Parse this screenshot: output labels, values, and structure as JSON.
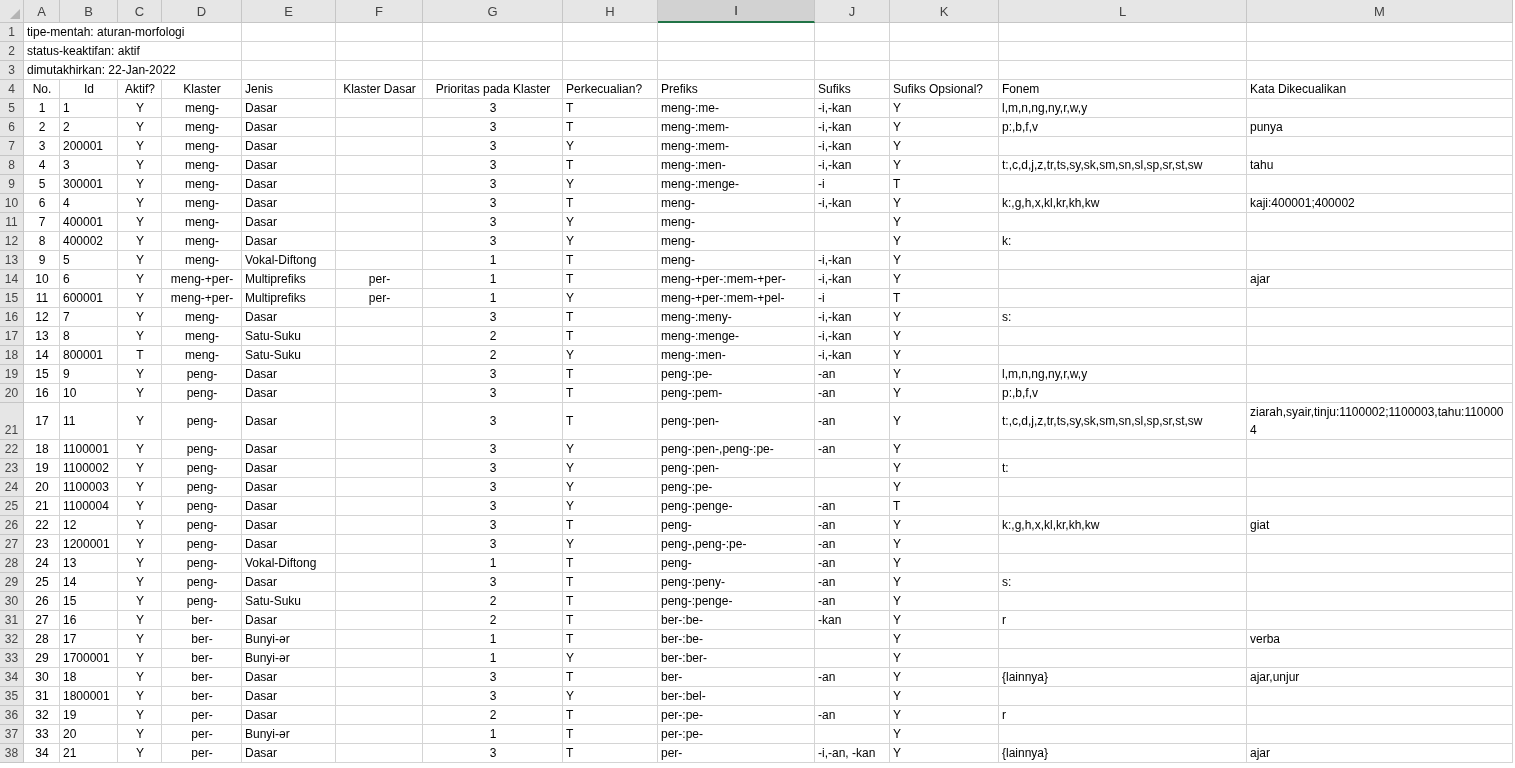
{
  "columns": [
    {
      "letter": "A",
      "selected": false
    },
    {
      "letter": "B",
      "selected": false
    },
    {
      "letter": "C",
      "selected": false
    },
    {
      "letter": "D",
      "selected": false
    },
    {
      "letter": "E",
      "selected": false
    },
    {
      "letter": "F",
      "selected": false
    },
    {
      "letter": "G",
      "selected": false
    },
    {
      "letter": "H",
      "selected": false
    },
    {
      "letter": "I",
      "selected": true
    },
    {
      "letter": "J",
      "selected": false
    },
    {
      "letter": "K",
      "selected": false
    },
    {
      "letter": "L",
      "selected": false
    },
    {
      "letter": "M",
      "selected": false
    }
  ],
  "rows": [
    {
      "n": "1",
      "title": "tipe-mentah: aturan-morfologi"
    },
    {
      "n": "2",
      "title": "status-keaktifan: aktif"
    },
    {
      "n": "3",
      "title": "dimutakhirkan: 22-Jan-2022"
    },
    {
      "n": "4",
      "header": true,
      "cells": [
        "No.",
        "Id",
        "Aktif?",
        "Klaster",
        "Jenis",
        "Klaster Dasar",
        "Prioritas pada Klaster",
        "Perkecualian?",
        "Prefiks",
        "Sufiks",
        "Sufiks Opsional?",
        "Fonem",
        "Kata Dikecualikan"
      ]
    },
    {
      "n": "5",
      "cells": [
        "1",
        "1",
        "Y",
        "meng-",
        "Dasar",
        null,
        "3",
        "T",
        "meng-:me-",
        "-i,-kan",
        "Y",
        "l,m,n,ng,ny,r,w,y",
        null
      ]
    },
    {
      "n": "6",
      "cells": [
        "2",
        "2",
        "Y",
        "meng-",
        "Dasar",
        null,
        "3",
        "T",
        "meng-:mem-",
        "-i,-kan",
        "Y",
        "p:,b,f,v",
        "punya"
      ]
    },
    {
      "n": "7",
      "cells": [
        "3",
        "200001",
        "Y",
        "meng-",
        "Dasar",
        null,
        "3",
        "Y",
        "meng-:mem-",
        "-i,-kan",
        "Y",
        null,
        null
      ]
    },
    {
      "n": "8",
      "cells": [
        "4",
        "3",
        "Y",
        "meng-",
        "Dasar",
        null,
        "3",
        "T",
        "meng-:men-",
        "-i,-kan",
        "Y",
        "t:,c,d,j,z,tr,ts,sy,sk,sm,sn,sl,sp,sr,st,sw",
        "tahu"
      ]
    },
    {
      "n": "9",
      "cells": [
        "5",
        "300001",
        "Y",
        "meng-",
        "Dasar",
        null,
        "3",
        "Y",
        "meng-:menge-",
        "-i",
        "T",
        null,
        null
      ]
    },
    {
      "n": "10",
      "cells": [
        "6",
        "4",
        "Y",
        "meng-",
        "Dasar",
        null,
        "3",
        "T",
        "meng-",
        "-i,-kan",
        "Y",
        "k:,g,h,x,kl,kr,kh,kw",
        "kaji:400001;400002"
      ]
    },
    {
      "n": "11",
      "cells": [
        "7",
        "400001",
        "Y",
        "meng-",
        "Dasar",
        null,
        "3",
        "Y",
        "meng-",
        null,
        "Y",
        null,
        null
      ]
    },
    {
      "n": "12",
      "cells": [
        "8",
        "400002",
        "Y",
        "meng-",
        "Dasar",
        null,
        "3",
        "Y",
        "meng-",
        null,
        "Y",
        "k:",
        null
      ]
    },
    {
      "n": "13",
      "cells": [
        "9",
        "5",
        "Y",
        "meng-",
        "Vokal-Diftong",
        null,
        "1",
        "T",
        "meng-",
        "-i,-kan",
        "Y",
        null,
        null
      ]
    },
    {
      "n": "14",
      "cells": [
        "10",
        "6",
        "Y",
        "meng-+per-",
        "Multiprefiks",
        "per-",
        "1",
        "T",
        "meng-+per-:mem-+per-",
        "-i,-kan",
        "Y",
        null,
        "ajar"
      ]
    },
    {
      "n": "15",
      "cells": [
        "11",
        "600001",
        "Y",
        "meng-+per-",
        "Multiprefiks",
        "per-",
        "1",
        "Y",
        "meng-+per-:mem-+pel-",
        "-i",
        "T",
        null,
        null
      ]
    },
    {
      "n": "16",
      "cells": [
        "12",
        "7",
        "Y",
        "meng-",
        "Dasar",
        null,
        "3",
        "T",
        "meng-:meny-",
        "-i,-kan",
        "Y",
        "s:",
        null
      ]
    },
    {
      "n": "17",
      "cells": [
        "13",
        "8",
        "Y",
        "meng-",
        "Satu-Suku",
        null,
        "2",
        "T",
        "meng-:menge-",
        "-i,-kan",
        "Y",
        null,
        null
      ]
    },
    {
      "n": "18",
      "cells": [
        "14",
        "800001",
        "T",
        "meng-",
        "Satu-Suku",
        null,
        "2",
        "Y",
        "meng-:men-",
        "-i,-kan",
        "Y",
        null,
        null
      ]
    },
    {
      "n": "19",
      "cells": [
        "15",
        "9",
        "Y",
        "peng-",
        "Dasar",
        null,
        "3",
        "T",
        "peng-:pe-",
        "-an",
        "Y",
        "l,m,n,ng,ny,r,w,y",
        null
      ]
    },
    {
      "n": "20",
      "cells": [
        "16",
        "10",
        "Y",
        "peng-",
        "Dasar",
        null,
        "3",
        "T",
        "peng-:pem-",
        "-an",
        "Y",
        "p:,b,f,v",
        null
      ]
    },
    {
      "n": "21",
      "cells": [
        "17",
        "11",
        "Y",
        "peng-",
        "Dasar",
        null,
        "3",
        "T",
        "peng-:pen-",
        "-an",
        "Y",
        "t:,c,d,j,z,tr,ts,sy,sk,sm,sn,sl,sp,sr,st,sw",
        "ziarah,syair,tinju:1100002;1100003,tahu:1100004"
      ]
    },
    {
      "n": "22",
      "cells": [
        "18",
        "1100001",
        "Y",
        "peng-",
        "Dasar",
        null,
        "3",
        "Y",
        "peng-:pen-,peng-:pe-",
        "-an",
        "Y",
        null,
        null
      ]
    },
    {
      "n": "23",
      "cells": [
        "19",
        "1100002",
        "Y",
        "peng-",
        "Dasar",
        null,
        "3",
        "Y",
        "peng-:pen-",
        null,
        "Y",
        "t:",
        null
      ]
    },
    {
      "n": "24",
      "cells": [
        "20",
        "1100003",
        "Y",
        "peng-",
        "Dasar",
        null,
        "3",
        "Y",
        "peng-:pe-",
        null,
        "Y",
        null,
        null
      ]
    },
    {
      "n": "25",
      "cells": [
        "21",
        "1100004",
        "Y",
        "peng-",
        "Dasar",
        null,
        "3",
        "Y",
        "peng-:penge-",
        "-an",
        "T",
        null,
        null
      ]
    },
    {
      "n": "26",
      "cells": [
        "22",
        "12",
        "Y",
        "peng-",
        "Dasar",
        null,
        "3",
        "T",
        "peng-",
        "-an",
        "Y",
        "k:,g,h,x,kl,kr,kh,kw",
        "giat"
      ]
    },
    {
      "n": "27",
      "cells": [
        "23",
        "1200001",
        "Y",
        "peng-",
        "Dasar",
        null,
        "3",
        "Y",
        "peng-,peng-:pe-",
        "-an",
        "Y",
        null,
        null
      ]
    },
    {
      "n": "28",
      "cells": [
        "24",
        "13",
        "Y",
        "peng-",
        "Vokal-Diftong",
        null,
        "1",
        "T",
        "peng-",
        "-an",
        "Y",
        null,
        null
      ]
    },
    {
      "n": "29",
      "cells": [
        "25",
        "14",
        "Y",
        "peng-",
        "Dasar",
        null,
        "3",
        "T",
        "peng-:peny-",
        "-an",
        "Y",
        "s:",
        null
      ]
    },
    {
      "n": "30",
      "cells": [
        "26",
        "15",
        "Y",
        "peng-",
        "Satu-Suku",
        null,
        "2",
        "T",
        "peng-:penge-",
        "-an",
        "Y",
        null,
        null
      ]
    },
    {
      "n": "31",
      "cells": [
        "27",
        "16",
        "Y",
        "ber-",
        "Dasar",
        null,
        "2",
        "T",
        "ber-:be-",
        "-kan",
        "Y",
        "r",
        null
      ]
    },
    {
      "n": "32",
      "cells": [
        "28",
        "17",
        "Y",
        "ber-",
        "Bunyi-ər",
        null,
        "1",
        "T",
        "ber-:be-",
        null,
        "Y",
        null,
        "verba"
      ]
    },
    {
      "n": "33",
      "cells": [
        "29",
        "1700001",
        "Y",
        "ber-",
        "Bunyi-ər",
        null,
        "1",
        "Y",
        "ber-:ber-",
        null,
        "Y",
        null,
        null
      ]
    },
    {
      "n": "34",
      "cells": [
        "30",
        "18",
        "Y",
        "ber-",
        "Dasar",
        null,
        "3",
        "T",
        "ber-",
        "-an",
        "Y",
        "{lainnya}",
        "ajar,unjur"
      ]
    },
    {
      "n": "35",
      "cells": [
        "31",
        "1800001",
        "Y",
        "ber-",
        "Dasar",
        null,
        "3",
        "Y",
        "ber-:bel-",
        null,
        "Y",
        null,
        null
      ]
    },
    {
      "n": "36",
      "cells": [
        "32",
        "19",
        "Y",
        "per-",
        "Dasar",
        null,
        "2",
        "T",
        "per-:pe-",
        "-an",
        "Y",
        "r",
        null
      ]
    },
    {
      "n": "37",
      "cells": [
        "33",
        "20",
        "Y",
        "per-",
        "Bunyi-ər",
        null,
        "1",
        "T",
        "per-:pe-",
        null,
        "Y",
        null,
        null
      ]
    },
    {
      "n": "38",
      "cells": [
        "34",
        "21",
        "Y",
        "per-",
        "Dasar",
        null,
        "3",
        "T",
        "per-",
        "-i,-an, -kan",
        "Y",
        "{lainnya}",
        "ajar"
      ]
    }
  ]
}
